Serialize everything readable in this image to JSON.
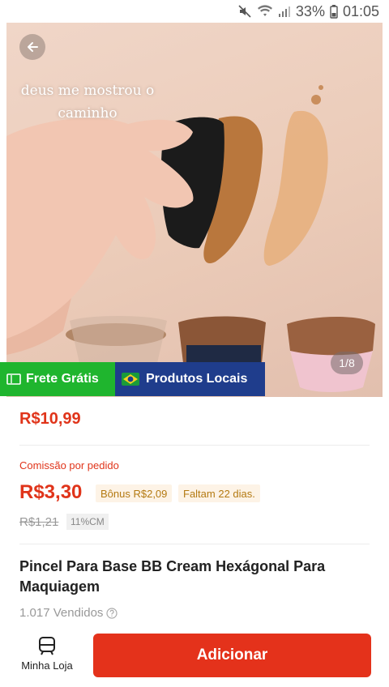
{
  "status_bar": {
    "battery_percent": "33%",
    "time": "01:05",
    "icons": [
      "mute-icon",
      "wifi-icon",
      "signal-icon",
      "battery-icon"
    ]
  },
  "product_image": {
    "overlay_text_line1": "deus me mostrou o",
    "overlay_text_line2": "caminho",
    "pager": "1/8",
    "back_icon": "arrow-left-icon"
  },
  "badges": {
    "frete": "Frete Grátis",
    "local": "Produtos Locais"
  },
  "pricing": {
    "price": "R$10,99",
    "commission_label": "Comissão por pedido",
    "commission": "R$3,30",
    "bonus": "Bônus R$2,09",
    "days_left": "Faltam 22 dias.",
    "old_commission": "R$1,21",
    "percent": "11%CM"
  },
  "product": {
    "title": "Pincel Para Base BB Cream Hexágonal Para Maquiagem",
    "sold": "1.017 Vendidos"
  },
  "actions": {
    "store_label": "Minha Loja",
    "add_label": "Adicionar"
  },
  "colors": {
    "accent": "#e4321b",
    "frete_green": "#1fb52e",
    "local_blue": "#1f3d8c"
  }
}
